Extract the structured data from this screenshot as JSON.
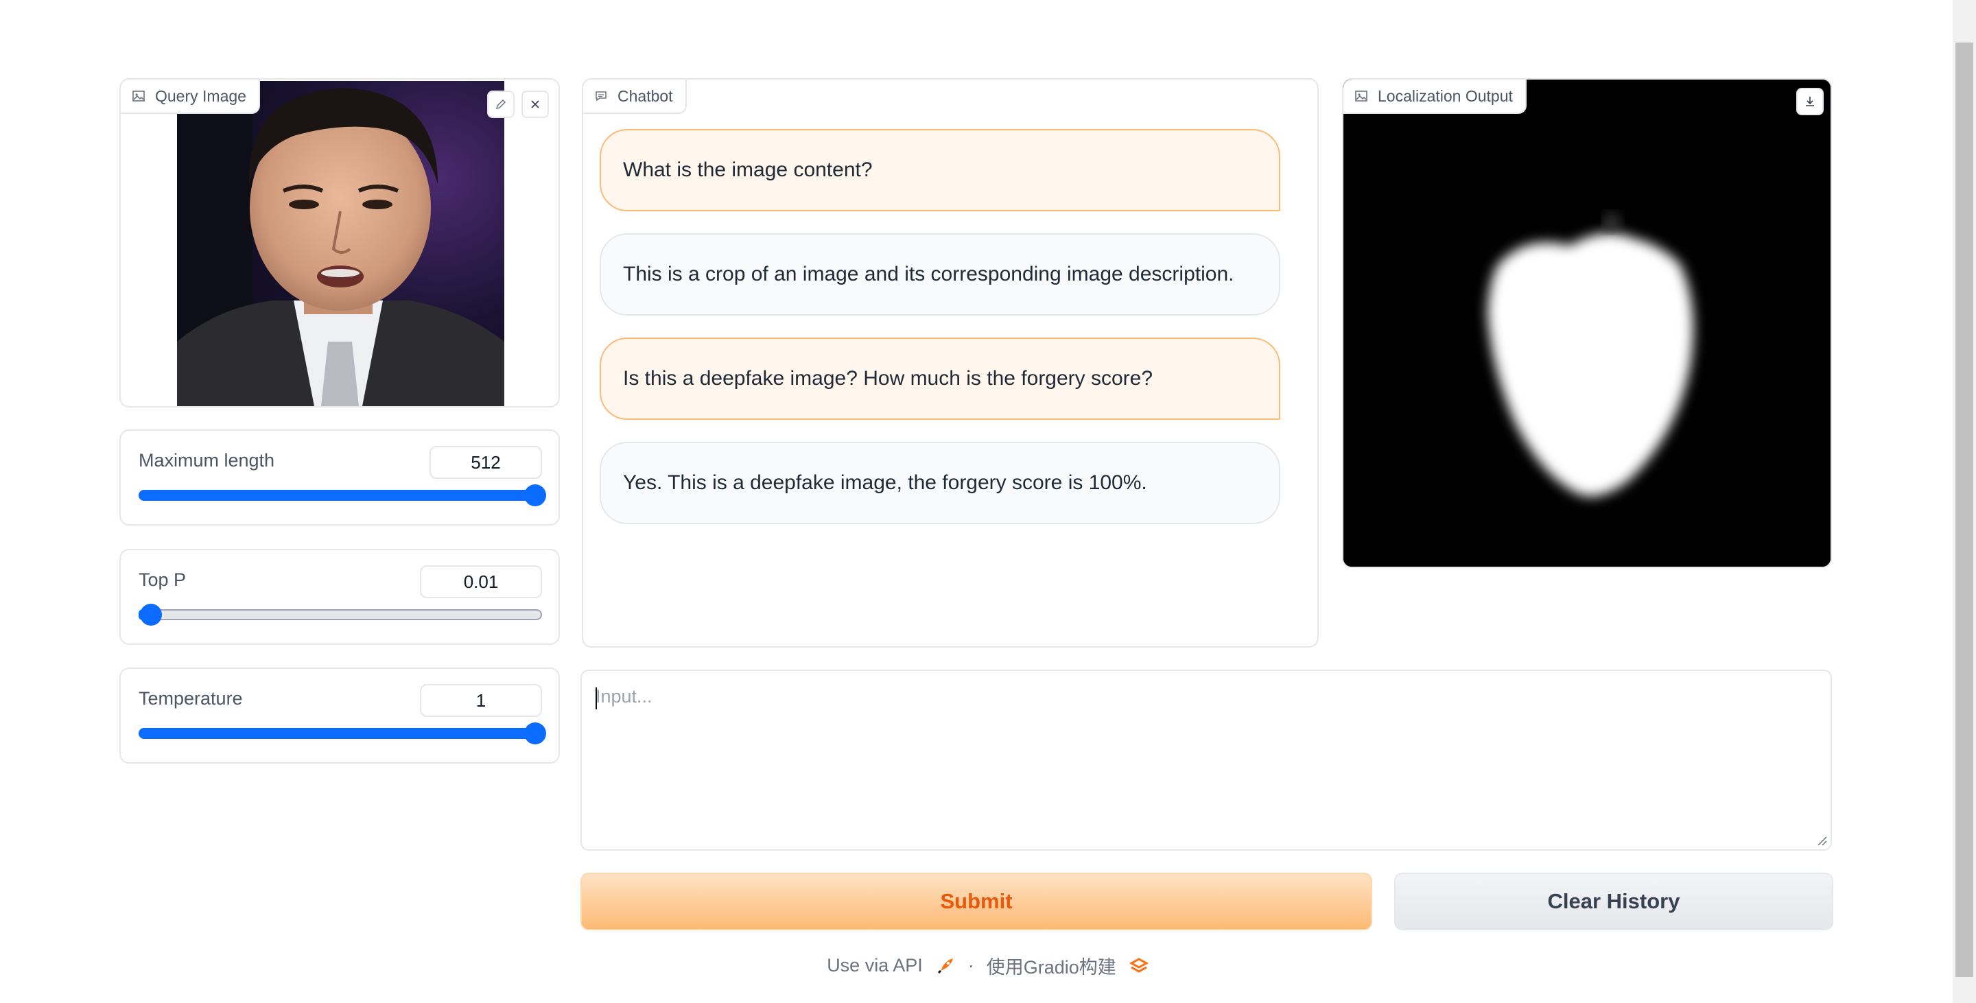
{
  "query_image": {
    "label": "Query Image",
    "edit_icon": "pencil-icon",
    "close_icon": "close-icon"
  },
  "sliders": {
    "max_length": {
      "label": "Maximum length",
      "value": "512",
      "fraction": 1.0
    },
    "top_p": {
      "label": "Top P",
      "value": "0.01",
      "fraction": 0.0
    },
    "temperature": {
      "label": "Temperature",
      "value": "1",
      "fraction": 1.0
    }
  },
  "chatbot": {
    "label": "Chatbot",
    "messages": [
      {
        "role": "user",
        "text": "What is the image content?"
      },
      {
        "role": "bot",
        "text": "This is a crop of an image and its corresponding image description."
      },
      {
        "role": "user",
        "text": "Is this a deepfake image? How much is the forgery score?"
      },
      {
        "role": "bot",
        "text": "Yes. This is a deepfake image, the forgery score is 100%."
      }
    ]
  },
  "localization": {
    "label": "Localization Output",
    "download_icon": "download-icon"
  },
  "input": {
    "placeholder": "Input..."
  },
  "buttons": {
    "submit": "Submit",
    "clear": "Clear History"
  },
  "footer": {
    "api": "Use via API",
    "separator": "·",
    "built_with": "使用Gradio构建"
  },
  "colors": {
    "accent_blue": "#0b6cff",
    "submit_orange": "#ea580c"
  }
}
